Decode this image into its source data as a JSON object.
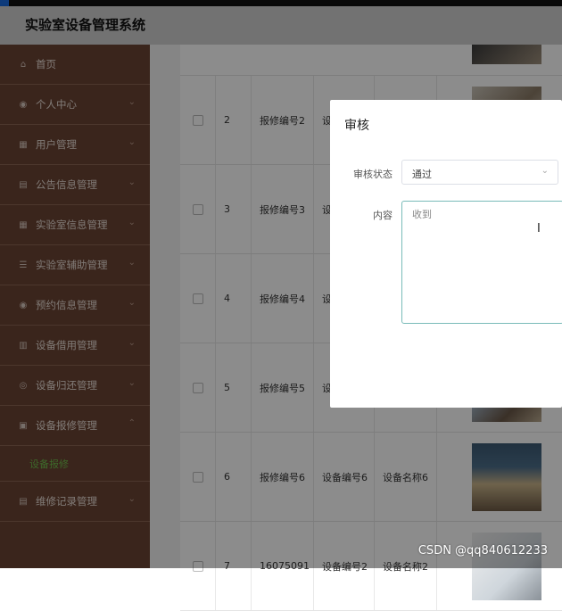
{
  "app": {
    "title": "实验室设备管理系统"
  },
  "sidebar": {
    "items": [
      {
        "label": "首页",
        "icon": "home-icon",
        "glyph": "⌂"
      },
      {
        "label": "个人中心",
        "icon": "user-icon",
        "glyph": "◉"
      },
      {
        "label": "用户管理",
        "icon": "users-icon",
        "glyph": "▦"
      },
      {
        "label": "公告信息管理",
        "icon": "notice-icon",
        "glyph": "▤"
      },
      {
        "label": "实验室信息管理",
        "icon": "grid-icon",
        "glyph": "▦"
      },
      {
        "label": "实验室辅助管理",
        "icon": "list-icon",
        "glyph": "☰"
      },
      {
        "label": "预约信息管理",
        "icon": "person-icon",
        "glyph": "◉"
      },
      {
        "label": "设备借用管理",
        "icon": "chart-icon",
        "glyph": "▥"
      },
      {
        "label": "设备归还管理",
        "icon": "circle-icon",
        "glyph": "◎"
      },
      {
        "label": "设备报修管理",
        "icon": "box-icon",
        "glyph": "▣"
      },
      {
        "label": "维修记录管理",
        "icon": "doc-icon",
        "glyph": "▤"
      }
    ],
    "sub_item": "设备报修"
  },
  "table": {
    "rows": [
      {
        "id": "2",
        "repair_no": "报修编号2",
        "device_no": "设",
        "device_name": ""
      },
      {
        "id": "3",
        "repair_no": "报修编号3",
        "device_no": "设",
        "device_name": ""
      },
      {
        "id": "4",
        "repair_no": "报修编号4",
        "device_no": "设",
        "device_name": ""
      },
      {
        "id": "5",
        "repair_no": "报修编号5",
        "device_no": "设",
        "device_name": ""
      },
      {
        "id": "6",
        "repair_no": "报修编号6",
        "device_no": "设备编号6",
        "device_name": "设备名称6"
      },
      {
        "id": "7",
        "repair_no": "16075091",
        "device_no": "设备编号2",
        "device_name": "设备名称2"
      }
    ]
  },
  "dialog": {
    "title": "审核",
    "status_label": "审核状态",
    "status_value": "通过",
    "content_label": "内容",
    "content_value": "收到"
  },
  "watermark": "CSDN @qq840612233"
}
